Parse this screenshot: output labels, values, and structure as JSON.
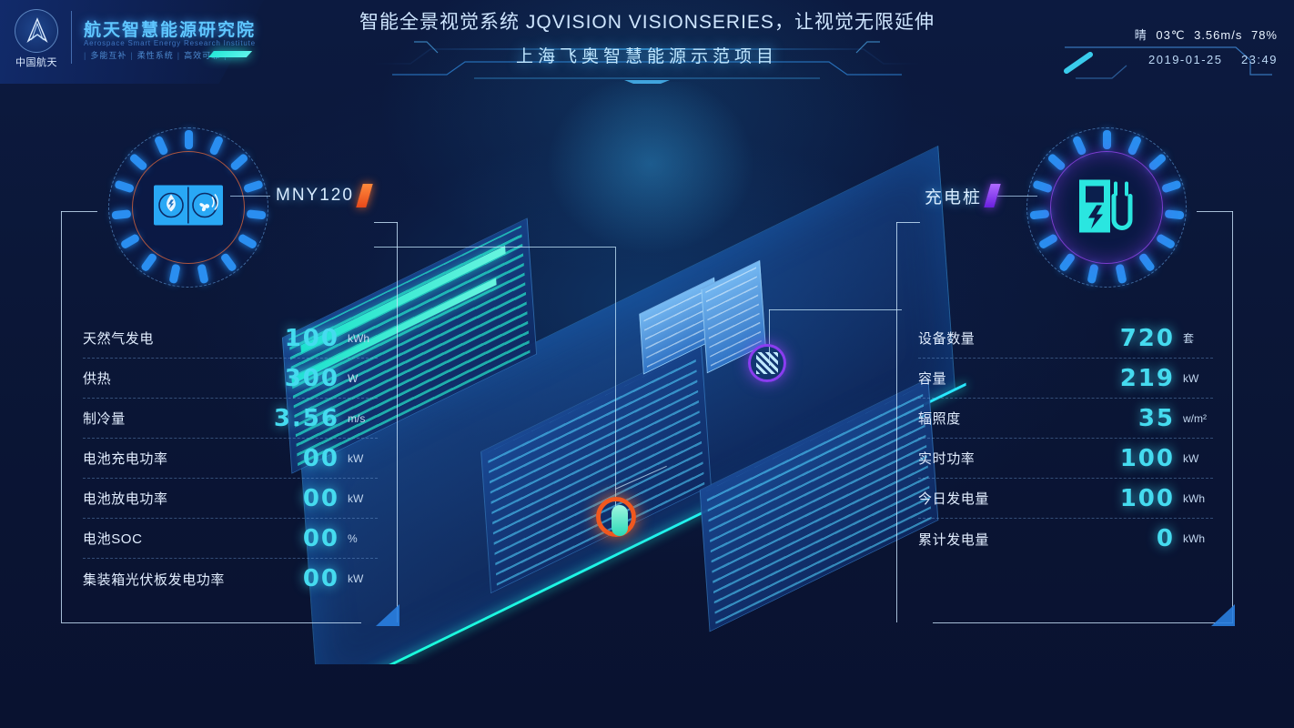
{
  "header": {
    "logo": {
      "emblem_text": "中国航天",
      "title": "航天智慧能源研究院",
      "subtitle": "Aerospace Smart Energy Research Institute",
      "tags": [
        "多能互补",
        "柔性系统",
        "高效可靠"
      ]
    },
    "top_title": "智能全景视觉系统 JQVISION VISIONSERIES，让视觉无限延伸",
    "project_name": "上海飞奥智慧能源示范项目",
    "hud": {
      "weather_condition": "晴",
      "temperature": "03℃",
      "wind_speed": "3.56m/s",
      "humidity": "78%",
      "date": "2019-01-25",
      "time": "23:49"
    }
  },
  "left_panel": {
    "badge_tag": "MNY120",
    "badge_icon": "water-fan-icon",
    "accent_color": "#e8491a",
    "rows": [
      {
        "label": "天然气发电",
        "value": "100",
        "unit": "kWh"
      },
      {
        "label": "供热",
        "value": "300",
        "unit": "W"
      },
      {
        "label": "制冷量",
        "value": "3.56",
        "unit": "m/s"
      },
      {
        "label": "电池充电功率",
        "value": "00",
        "unit": "kW"
      },
      {
        "label": "电池放电功率",
        "value": "00",
        "unit": "kW"
      },
      {
        "label": "电池SOC",
        "value": "00",
        "unit": "%"
      },
      {
        "label": "集装箱光伏板发电功率",
        "value": "00",
        "unit": "kW"
      }
    ]
  },
  "right_panel": {
    "badge_tag": "充电桩",
    "badge_icon": "ev-charger-icon",
    "accent_color": "#6a1fe0",
    "rows": [
      {
        "label": "设备数量",
        "value": "720",
        "unit": "套"
      },
      {
        "label": "容量",
        "value": "219",
        "unit": "kW"
      },
      {
        "label": "辐照度",
        "value": "35",
        "unit": "w/m²"
      },
      {
        "label": "实时功率",
        "value": "100",
        "unit": "kW"
      },
      {
        "label": "今日发电量",
        "value": "100",
        "unit": "kWh"
      },
      {
        "label": "累计发电量",
        "value": "0",
        "unit": "kWh"
      }
    ]
  },
  "scene": {
    "description": "isometric-industrial-park-3d-view"
  }
}
